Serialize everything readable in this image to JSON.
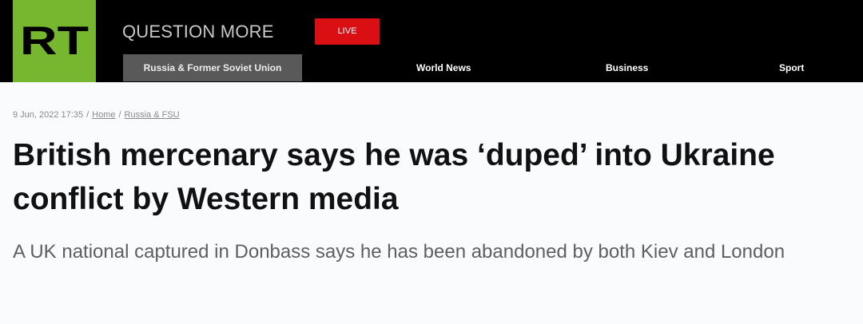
{
  "header": {
    "logo_text": "RT",
    "tagline": "QUESTION MORE",
    "live_label": "LIVE",
    "nav": [
      {
        "label": "Russia & Former Soviet Union",
        "active": true
      },
      {
        "label": "World News",
        "active": false
      },
      {
        "label": "Business",
        "active": false
      },
      {
        "label": "Sport",
        "active": false
      }
    ]
  },
  "article": {
    "date": "9 Jun, 2022 17:35",
    "breadcrumb": [
      "Home",
      "Russia & FSU"
    ],
    "title": "British mercenary says he was ‘duped’ into Ukraine conflict by Western media",
    "subtitle": "A UK national captured in Donbass says he has been abandoned by both Kiev and London"
  },
  "colors": {
    "brand_green": "#77b72f",
    "live_red": "#d90f13",
    "header_bg": "#000000",
    "active_nav_bg": "#595959"
  }
}
